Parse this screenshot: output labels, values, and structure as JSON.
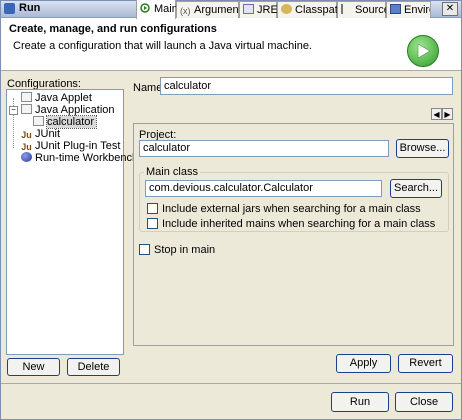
{
  "window": {
    "title": "Run",
    "close_glyph": "✕"
  },
  "header": {
    "title": "Create, manage, and run configurations",
    "description": "Create a configuration that will launch a Java virtual machine."
  },
  "configurations": {
    "label": "Configurations:",
    "items": [
      {
        "label": "Java Applet",
        "icon": "java-applet-icon"
      },
      {
        "label": "Java Application",
        "icon": "java-application-icon"
      },
      {
        "label": "calculator",
        "icon": "java-file-icon"
      },
      {
        "label": "JUnit",
        "icon": "junit-icon"
      },
      {
        "label": "JUnit Plug-in Test",
        "icon": "junit-plugin-icon"
      },
      {
        "label": "Run-time Workbench",
        "icon": "workbench-icon"
      }
    ],
    "new_label": "New",
    "delete_label": "Delete"
  },
  "name_field": {
    "label": "Name:",
    "value": "calculator"
  },
  "tabs": [
    {
      "label": "Main",
      "icon": "main-tab-icon"
    },
    {
      "label": "Arguments",
      "icon": "arguments-tab-icon"
    },
    {
      "label": "JRE",
      "icon": "jre-tab-icon"
    },
    {
      "label": "Classpath",
      "icon": "classpath-tab-icon"
    },
    {
      "label": "Source",
      "icon": "source-tab-icon"
    },
    {
      "label": "Environ",
      "icon": "environment-tab-icon"
    }
  ],
  "main_tab": {
    "project_label": "Project:",
    "project_value": "calculator",
    "browse_label": "Browse...",
    "main_class_group": "Main class",
    "main_class_value": "com.devious.calculator.Calculator",
    "search_label": "Search...",
    "include_external": "Include external jars when searching for a main class",
    "include_inherited": "Include inherited mains when searching for a main class",
    "stop_in_main": "Stop in main"
  },
  "actions": {
    "apply": "Apply",
    "revert": "Revert",
    "run": "Run",
    "close": "Close"
  }
}
